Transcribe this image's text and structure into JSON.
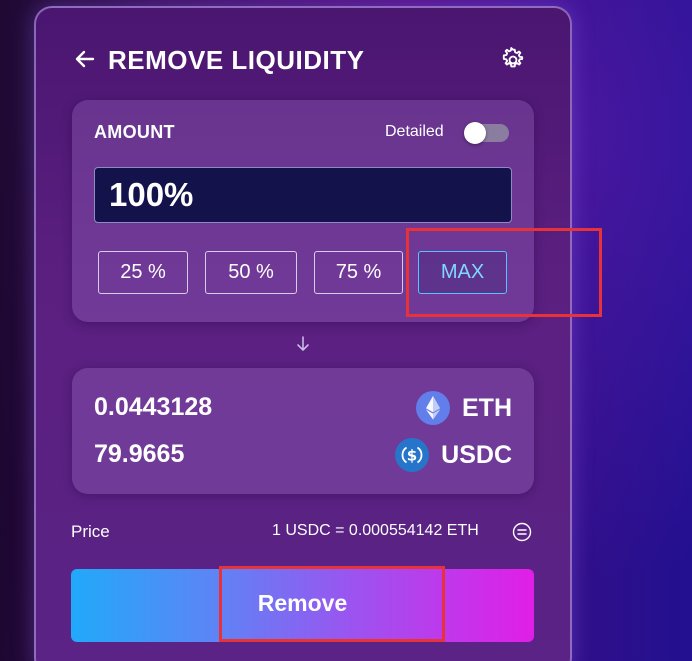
{
  "header": {
    "title": "REMOVE LIQUIDITY",
    "back_icon": "arrow-left-icon",
    "settings_icon": "gear-icon"
  },
  "amount": {
    "label": "AMOUNT",
    "detailed_label": "Detailed",
    "detailed_enabled": false,
    "value": "100%",
    "presets": [
      {
        "label": "25 %"
      },
      {
        "label": "50 %"
      },
      {
        "label": "75 %"
      },
      {
        "label": "MAX",
        "active": true
      }
    ]
  },
  "output": {
    "tokens": [
      {
        "amount": "0.0443128",
        "symbol": "ETH",
        "icon": "ethereum-icon",
        "color": "#627eea"
      },
      {
        "amount": "79.9665",
        "symbol": "USDC",
        "icon": "usdc-icon",
        "color": "#2775ca"
      }
    ]
  },
  "price": {
    "label": "Price",
    "value": "1 USDC = 0.000554142 ETH",
    "swap_icon": "swap-rate-icon"
  },
  "actions": {
    "remove_label": "Remove"
  },
  "colors": {
    "highlight": "#e8323a",
    "accent_blue": "#21a9fa",
    "accent_pink": "#e11ee6"
  }
}
